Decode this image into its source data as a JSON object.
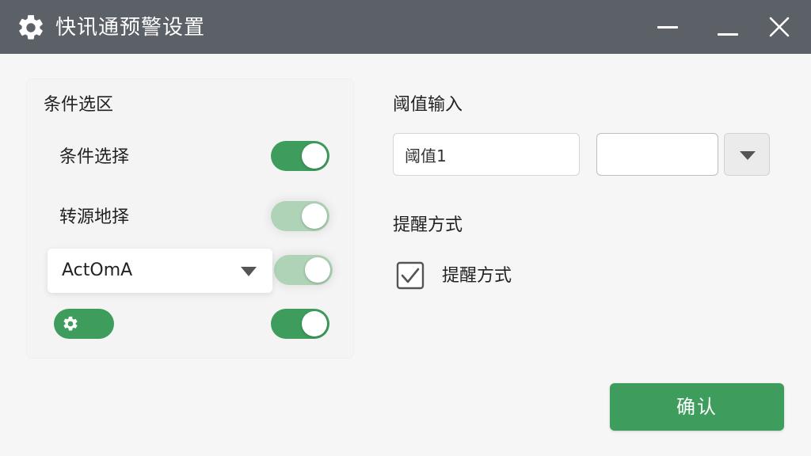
{
  "window": {
    "title": "快讯通预警设置",
    "title_icon": "gear-icon",
    "controls": [
      "minimize-icon",
      "minimize-icon",
      "close-icon"
    ]
  },
  "left_panel": {
    "title": "条件选区",
    "rows": [
      {
        "label": "条件选择",
        "toggle_on": true
      },
      {
        "label": "转源地择",
        "toggle_on": true,
        "toggle_faded": true
      }
    ],
    "dropdown": {
      "value": "ActOmA",
      "icon": "chevron-down-icon"
    },
    "dropdown_toggle_on": true,
    "settings_pill_icon": "gear-icon",
    "bottom_toggle_on": true
  },
  "right_panel": {
    "threshold_title": "阈值输入",
    "threshold_input_1": {
      "value": "阈值1"
    },
    "threshold_input_2": {
      "value": ""
    },
    "threshold_dropdown_icon": "chevron-down-icon",
    "reminder_title": "提醒方式",
    "reminder_checkbox": {
      "label": "提醒方式",
      "checked": true
    }
  },
  "footer": {
    "confirm_label": "确认"
  },
  "colors": {
    "titlebar": "#5c6067",
    "accent": "#3e9d5c",
    "accent_faded": "#aed3b6",
    "background": "#f6f6f6"
  }
}
